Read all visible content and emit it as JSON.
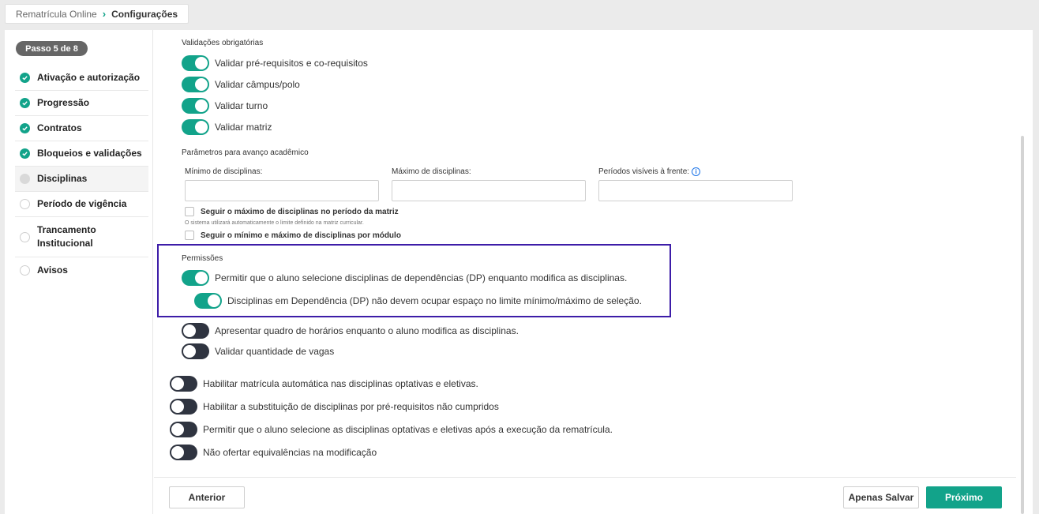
{
  "breadcrumb": {
    "root": "Rematrícula Online",
    "current": "Configurações"
  },
  "sidebar": {
    "step_badge": "Passo 5 de 8",
    "steps": [
      {
        "label": "Ativação e autorização",
        "status": "done"
      },
      {
        "label": "Progressão",
        "status": "done"
      },
      {
        "label": "Contratos",
        "status": "done"
      },
      {
        "label": "Bloqueios e validações",
        "status": "done"
      },
      {
        "label": "Disciplinas",
        "status": "current"
      },
      {
        "label": "Período de vigência",
        "status": "pending"
      },
      {
        "label": "Trancamento Institucional",
        "status": "pending"
      },
      {
        "label": "Avisos",
        "status": "pending"
      }
    ]
  },
  "validacoes": {
    "title": "Validações obrigatórias",
    "toggles": [
      {
        "label": "Validar pré-requisitos e co-requisitos",
        "on": true
      },
      {
        "label": "Validar câmpus/polo",
        "on": true
      },
      {
        "label": "Validar turno",
        "on": true
      },
      {
        "label": "Validar matriz",
        "on": true
      }
    ]
  },
  "parametros": {
    "title": "Parâmetros para avanço acadêmico",
    "min_label": "Mínimo de disciplinas:",
    "min_value": "",
    "max_label": "Máximo de disciplinas:",
    "max_value": "",
    "periodos_label": "Períodos visíveis à frente:",
    "periodos_value": "",
    "check_max_matriz": "Seguir o máximo de disciplinas no período da matriz",
    "check_max_matriz_hint": "O sistema utilizará automaticamente o limite definido na matriz curricular.",
    "check_modulo": "Seguir o mínimo e máximo de disciplinas por módulo"
  },
  "permissoes": {
    "title": "Permissões",
    "dp_toggle": "Permitir que o aluno selecione disciplinas de dependências (DP) enquanto modifica as disciplinas.",
    "dp_sub_toggle": "Disciplinas em Dependência (DP) não devem ocupar espaço no limite mínimo/máximo de seleção.",
    "quadro_toggle": "Apresentar quadro de horários enquanto o aluno modifica as disciplinas.",
    "vagas_toggle": "Validar quantidade de vagas"
  },
  "outras": {
    "auto_optativas": "Habilitar matrícula automática nas disciplinas optativas e eletivas.",
    "substituicao": "Habilitar a substituição de disciplinas por pré-requisitos não cumpridos",
    "optativas_apos": "Permitir que o aluno selecione as disciplinas optativas e eletivas após a execução da rematrícula.",
    "nao_equivalencias": "Não ofertar equivalências na modificação"
  },
  "footer": {
    "anterior": "Anterior",
    "apenas_salvar": "Apenas Salvar",
    "proximo": "Próximo"
  },
  "colors": {
    "accent": "#12a38a",
    "highlight": "#3d1da8",
    "toggle_off": "#2f3440"
  }
}
